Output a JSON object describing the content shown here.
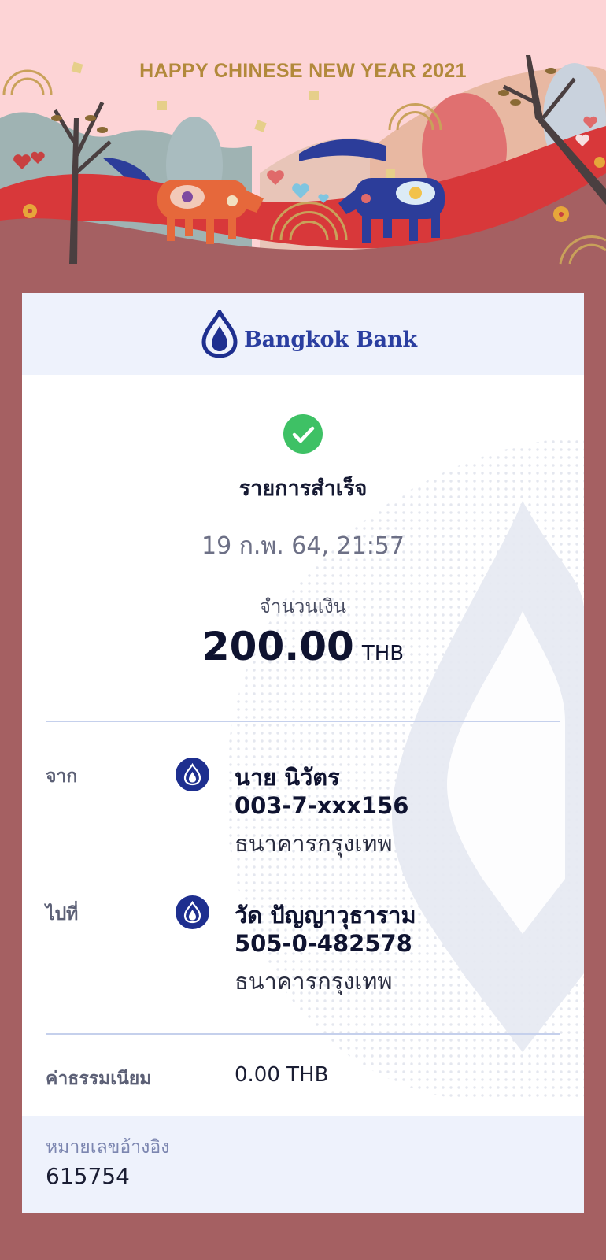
{
  "banner": {
    "title": "HAPPY CHINESE NEW YEAR 2021"
  },
  "bank": {
    "name": "Bangkok Bank",
    "logo_icon": "lotus-logo-icon"
  },
  "transaction": {
    "status_icon": "check-circle-icon",
    "status": "รายการสำเร็จ",
    "datetime": "19 ก.พ. 64, 21:57",
    "amount_label": "จำนวนเงิน",
    "amount": "200.00",
    "currency": "THB"
  },
  "from": {
    "label": "จาก",
    "icon": "bank-lotus-icon",
    "name": "นาย นิวัตร",
    "account": "003-7-xxx156",
    "bank": "ธนาคารกรุงเทพ"
  },
  "to": {
    "label": "ไปที่",
    "icon": "bank-lotus-icon",
    "name": "วัด ปัญญาวุธาราม",
    "account": "505-0-482578",
    "bank": "ธนาคารกรุงเทพ"
  },
  "fee": {
    "label": "ค่าธรรมเนียม",
    "value": "0.00 THB"
  },
  "reference": {
    "label": "หมายเลขอ้างอิง",
    "value": "615754"
  },
  "colors": {
    "background": "#a56062",
    "banner_bg": "#fdd4d6",
    "brand_blue": "#1e2f8f",
    "success_green": "#3ec165",
    "title_gold": "#b2893b"
  }
}
